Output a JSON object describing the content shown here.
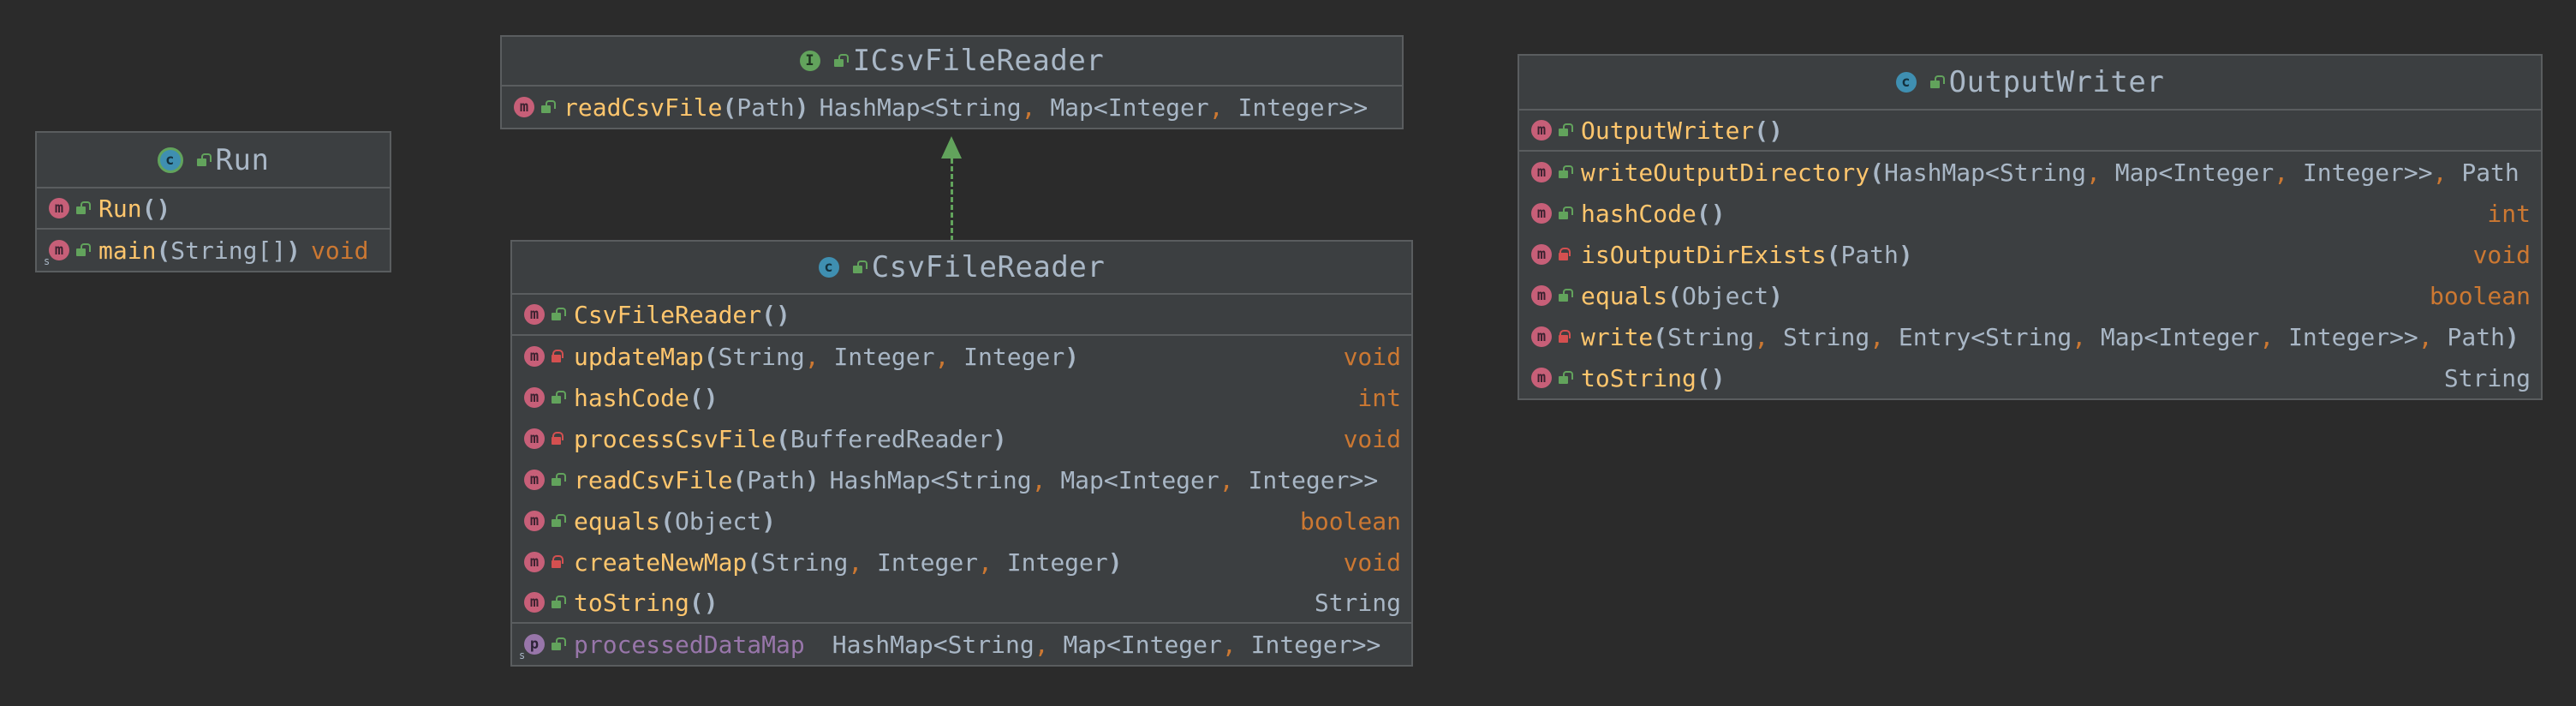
{
  "classes": {
    "run": {
      "name": "Run",
      "kind_icon": "main-class-icon",
      "rows": [
        {
          "name": "Run",
          "params": "",
          "return": "",
          "return_kind": "none"
        },
        {
          "name": "main",
          "params": "String[]",
          "return": "void",
          "return_kind": "keyword"
        }
      ]
    },
    "icsv": {
      "name": "ICsvFileReader",
      "kind_icon": "interface-icon",
      "rows": [
        {
          "name": "readCsvFile",
          "params": "Path",
          "return": "HashMap<String, Map<Integer, Integer>>",
          "return_kind": "type"
        }
      ]
    },
    "csv": {
      "name": "CsvFileReader",
      "kind_icon": "class-icon",
      "rows": [
        {
          "name": "CsvFileReader",
          "params": "",
          "return": "",
          "visibility": "public"
        },
        {
          "name": "updateMap",
          "params": "String, Integer, Integer",
          "return": "void",
          "visibility": "private"
        },
        {
          "name": "hashCode",
          "params": "",
          "return": "int",
          "visibility": "public"
        },
        {
          "name": "processCsvFile",
          "params": "BufferedReader",
          "return": "void",
          "visibility": "private"
        },
        {
          "name": "readCsvFile",
          "params": "Path",
          "return": "HashMap<String, Map<Integer, Integer>>",
          "visibility": "public"
        },
        {
          "name": "equals",
          "params": "Object",
          "return": "boolean",
          "visibility": "public"
        },
        {
          "name": "createNewMap",
          "params": "String, Integer, Integer",
          "return": "void",
          "visibility": "private"
        },
        {
          "name": "toString",
          "params": "",
          "return": "String",
          "visibility": "public"
        }
      ],
      "property": {
        "name": "processedDataMap",
        "type": "HashMap<String, Map<Integer, Integer>>"
      }
    },
    "output": {
      "name": "OutputWriter",
      "kind_icon": "class-icon",
      "rows": [
        {
          "name": "OutputWriter",
          "params": "",
          "return": "",
          "visibility": "public"
        },
        {
          "name": "writeOutputDirectory",
          "params": "HashMap<String, Map<Integer, Integer>>, Path",
          "return": "",
          "visibility": "public"
        },
        {
          "name": "hashCode",
          "params": "",
          "return": "int",
          "visibility": "public"
        },
        {
          "name": "isOutputDirExists",
          "params": "Path",
          "return": "void",
          "visibility": "private"
        },
        {
          "name": "equals",
          "params": "Object",
          "return": "boolean",
          "visibility": "public"
        },
        {
          "name": "write",
          "params": "String, String, Entry<String, Map<Integer, Integer>>, Path",
          "return": "",
          "visibility": "private"
        },
        {
          "name": "toString",
          "params": "",
          "return": "String",
          "visibility": "public"
        }
      ]
    }
  },
  "relations": [
    {
      "from": "CsvFileReader",
      "to": "ICsvFileReader",
      "kind": "implements"
    }
  ],
  "colors": {
    "background": "#2b2b2b",
    "box": "#3c3f41",
    "method_name": "#ffc66d",
    "keyword": "#cc7832",
    "text": "#a9b7c6",
    "property": "#9876aa",
    "arrow": "#62a35c"
  }
}
